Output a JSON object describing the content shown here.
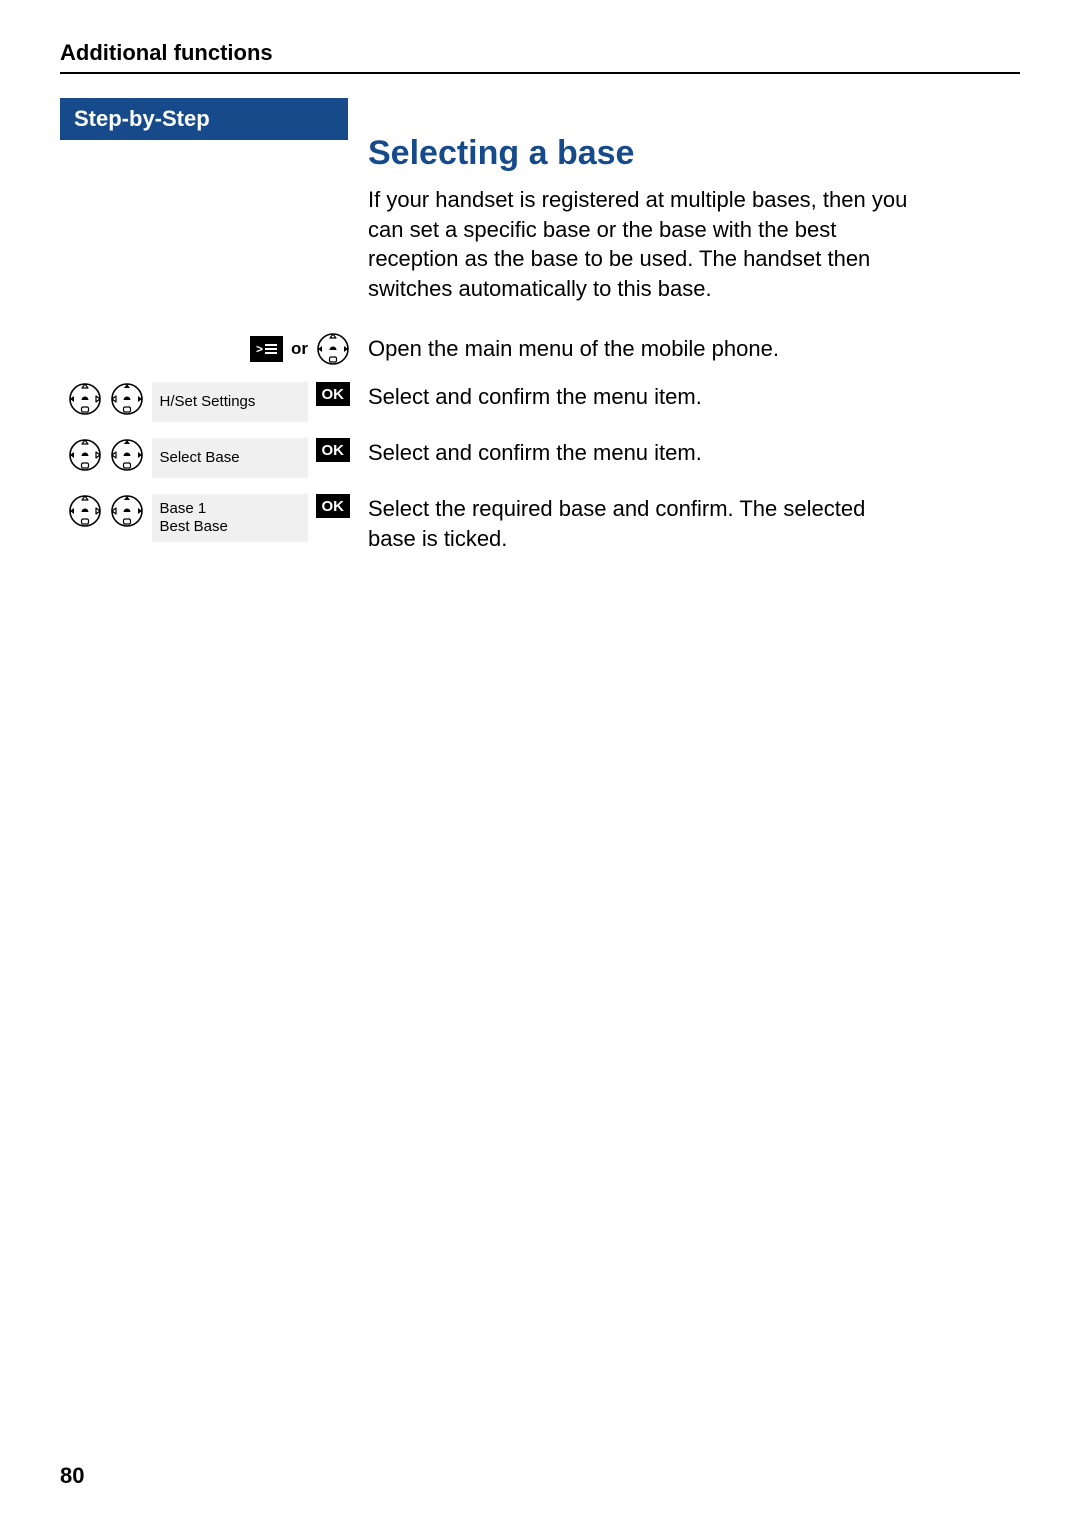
{
  "header": {
    "running_head": "Additional functions",
    "step_bar": "Step-by-Step"
  },
  "section": {
    "title": "Selecting a base",
    "intro": "If your handset is registered at multiple bases, then you can set a specific base or the base with the best reception as the base to be used. The handset then switches automatically to this base."
  },
  "labels": {
    "or": "or",
    "ok": "OK"
  },
  "steps": [
    {
      "left_text": "",
      "right_text": "Open the main menu of the mobile phone."
    },
    {
      "left_text": "H/Set Settings",
      "right_text": "Select and confirm the menu item."
    },
    {
      "left_text": "Select Base",
      "right_text": "Select and confirm the menu item."
    },
    {
      "left_text_line1": "Base 1",
      "left_text_line2": "Best Base",
      "right_text": "Select the required base and confirm. The selected base is ticked."
    }
  ],
  "footer": {
    "page_number": "80"
  }
}
